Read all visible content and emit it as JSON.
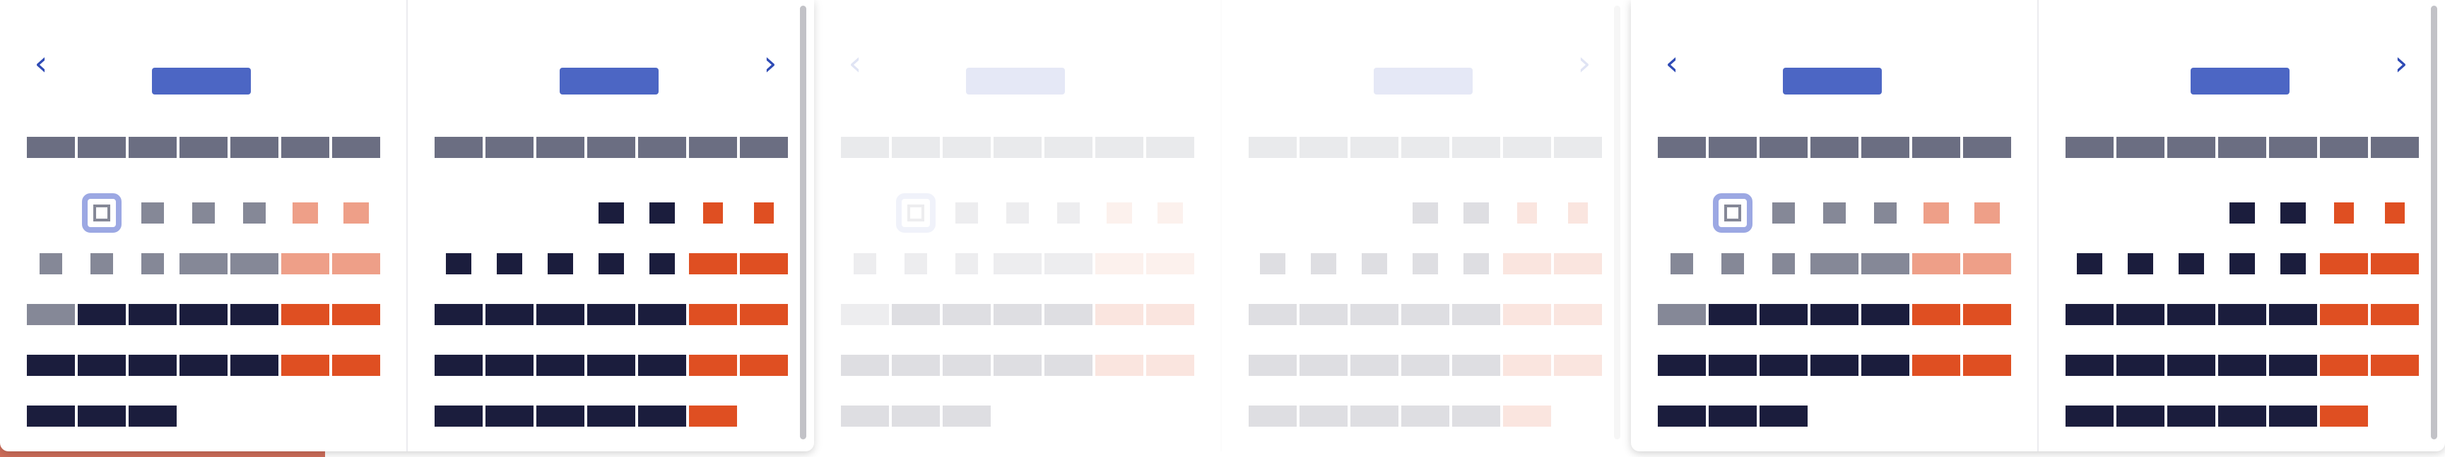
{
  "calendars": [
    {
      "variant": "normal",
      "prev_icon": "‹",
      "next_icon": "›",
      "months": [
        {
          "title": "",
          "year": "",
          "weekdays": [
            "",
            "",
            "",
            "",
            "",
            "",
            ""
          ],
          "weeks": [
            [
              null,
              {
                "d": "",
                "s": "today"
              },
              {
                "d": "",
                "s": "past"
              },
              {
                "d": "",
                "s": "past"
              },
              {
                "d": "",
                "s": "past"
              },
              {
                "d": "",
                "s": "past-we"
              },
              {
                "d": "",
                "s": "past-we"
              }
            ],
            [
              {
                "d": "",
                "s": "past"
              },
              {
                "d": "",
                "s": "past"
              },
              {
                "d": "",
                "s": "past"
              },
              {
                "d": "",
                "s": "past",
                "w": 1
              },
              {
                "d": "",
                "s": "past",
                "w": 1
              },
              {
                "d": "",
                "s": "past-we",
                "w": 1
              },
              {
                "d": "",
                "s": "past-we",
                "w": 1
              }
            ],
            [
              {
                "d": "",
                "s": "past",
                "w": 1
              },
              {
                "d": "",
                "s": "cur"
              },
              {
                "d": "",
                "s": "cur"
              },
              {
                "d": "",
                "s": "cur"
              },
              {
                "d": "",
                "s": "cur"
              },
              {
                "d": "",
                "s": "we"
              },
              {
                "d": "",
                "s": "we"
              }
            ],
            [
              {
                "d": "",
                "s": "cur"
              },
              {
                "d": "",
                "s": "cur"
              },
              {
                "d": "",
                "s": "cur"
              },
              {
                "d": "",
                "s": "cur"
              },
              {
                "d": "",
                "s": "cur"
              },
              {
                "d": "",
                "s": "we"
              },
              {
                "d": "",
                "s": "we"
              }
            ],
            [
              {
                "d": "",
                "s": "cur"
              },
              {
                "d": "",
                "s": "cur"
              },
              {
                "d": "",
                "s": "cur"
              },
              null,
              null,
              null,
              null
            ]
          ]
        },
        {
          "title": "",
          "year": "",
          "weekdays": [
            "",
            "",
            "",
            "",
            "",
            "",
            ""
          ],
          "weeks": [
            [
              null,
              null,
              null,
              {
                "d": "",
                "s": "cur",
                "n": 1
              },
              {
                "d": "",
                "s": "cur",
                "n": 1
              },
              {
                "d": "",
                "s": "we",
                "n": 1
              },
              {
                "d": "",
                "s": "we",
                "n": 1
              }
            ],
            [
              {
                "d": "",
                "s": "cur",
                "n": 1
              },
              {
                "d": "",
                "s": "cur",
                "n": 1
              },
              {
                "d": "",
                "s": "cur",
                "n": 1
              },
              {
                "d": "",
                "s": "cur",
                "n": 1
              },
              {
                "d": "",
                "s": "cur",
                "n": 1
              },
              {
                "d": "",
                "s": "we"
              },
              {
                "d": "",
                "s": "we"
              }
            ],
            [
              {
                "d": "",
                "s": "cur"
              },
              {
                "d": "",
                "s": "cur"
              },
              {
                "d": "",
                "s": "cur"
              },
              {
                "d": "",
                "s": "cur"
              },
              {
                "d": "",
                "s": "cur"
              },
              {
                "d": "",
                "s": "we"
              },
              {
                "d": "",
                "s": "we"
              }
            ],
            [
              {
                "d": "",
                "s": "cur"
              },
              {
                "d": "",
                "s": "cur"
              },
              {
                "d": "",
                "s": "cur"
              },
              {
                "d": "",
                "s": "cur"
              },
              {
                "d": "",
                "s": "cur"
              },
              {
                "d": "",
                "s": "we"
              },
              {
                "d": "",
                "s": "we"
              }
            ],
            [
              {
                "d": "",
                "s": "cur"
              },
              {
                "d": "",
                "s": "cur"
              },
              {
                "d": "",
                "s": "cur"
              },
              {
                "d": "",
                "s": "cur"
              },
              {
                "d": "",
                "s": "cur"
              },
              {
                "d": "",
                "s": "we"
              },
              null
            ]
          ]
        }
      ]
    },
    {
      "variant": "faded",
      "same_as": 0
    },
    {
      "variant": "normal",
      "same_as": 0
    }
  ],
  "colors": {
    "accent": "#4c66c4",
    "title": "#1d1f3f",
    "weekday_bg": "#6b6e82",
    "day_current": "#1b1d3d",
    "day_weekend": "#df4f22",
    "day_past": "#858897",
    "day_past_weekend": "#ee9f88",
    "today_ring": "#9ca8e3"
  }
}
